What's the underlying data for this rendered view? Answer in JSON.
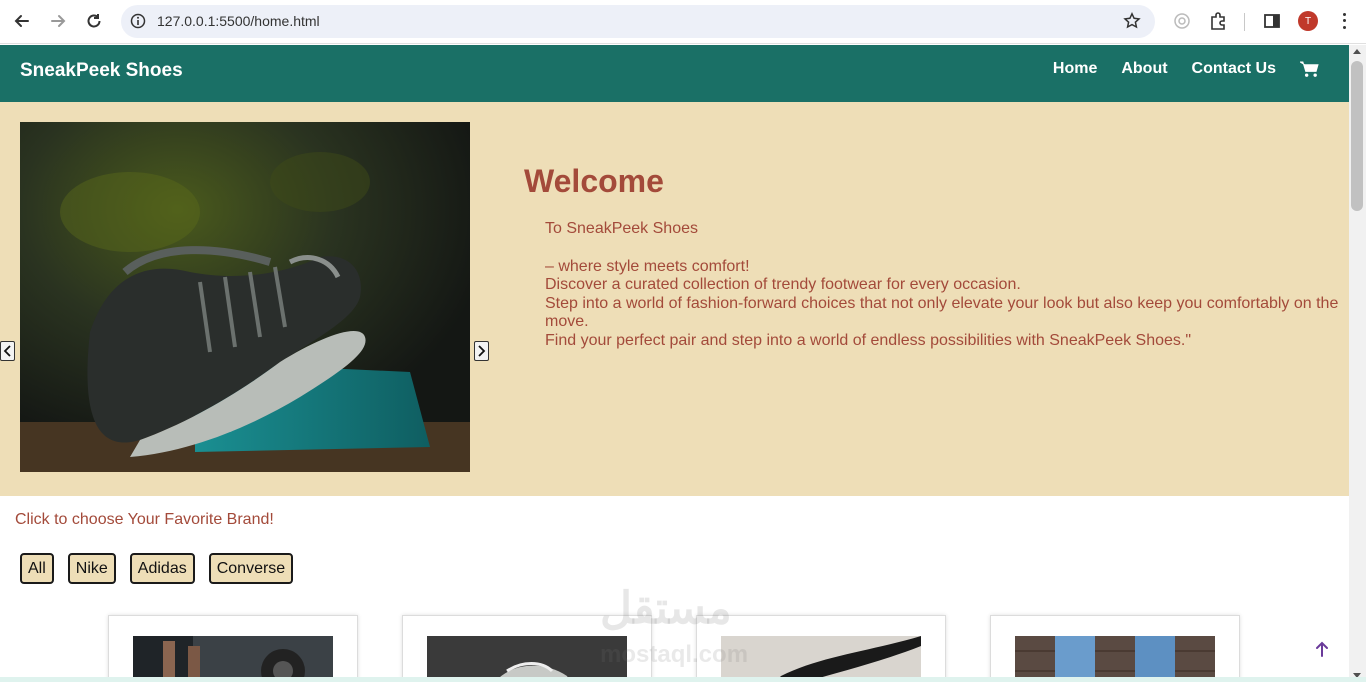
{
  "browser": {
    "url": "127.0.0.1:5500/home.html",
    "profile_initial": "T"
  },
  "navbar": {
    "brand": "SneakPeek Shoes",
    "links": [
      "Home",
      "About",
      "Contact Us"
    ]
  },
  "hero": {
    "title": "Welcome",
    "subtitle": "To SneakPeek Shoes",
    "lines": [
      "– where style meets comfort!",
      "Discover a curated collection of trendy footwear for every occasion.",
      "Step into a world of fashion-forward choices that not only elevate your look but also keep you comfortably on the move.",
      "Find your perfect pair and step into a world of endless possibilities with SneakPeek Shoes.\""
    ]
  },
  "brands": {
    "prompt": "Click to choose Your Favorite Brand!",
    "filters": [
      "All",
      "Nike",
      "Adidas",
      "Converse"
    ]
  },
  "watermark": {
    "main": "مستقل",
    "sub": "mostaql.com"
  },
  "colors": {
    "nav_bg": "#1a7066",
    "hero_bg": "#eedeb7",
    "accent_text": "#a34a3a"
  }
}
